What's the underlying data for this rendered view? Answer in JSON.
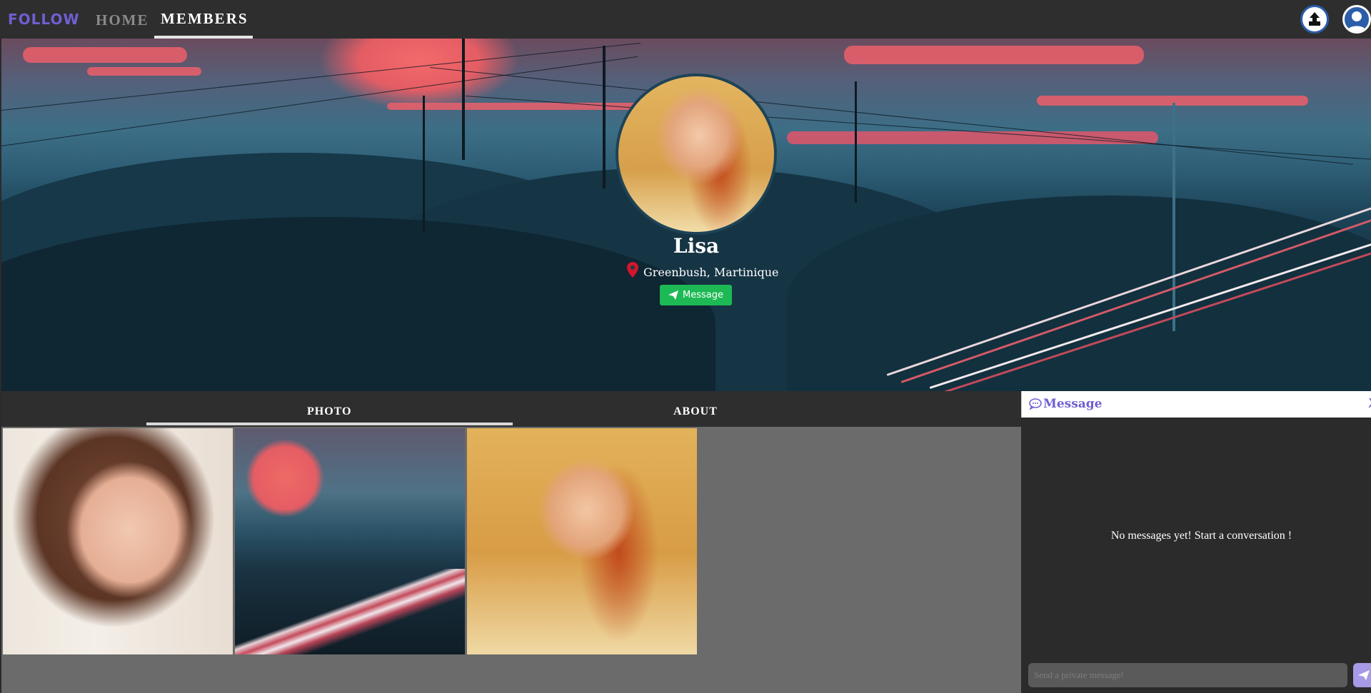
{
  "nav": {
    "logo": "FOLLOW",
    "home_label": "HOME",
    "members_label": "MEMBERS"
  },
  "profile": {
    "name": "Lisa",
    "location": "Greenbush, Martinique",
    "message_button": "Message"
  },
  "tabs": {
    "photo": "PHOTO",
    "about": "ABOUT"
  },
  "chat": {
    "title": "Message",
    "close": "X",
    "empty_text": "No messages yet! Start a conversation !",
    "input_placeholder": "Send a private message!"
  },
  "icons": {
    "upload": "upload-icon",
    "user": "user-icon",
    "location": "map-pin-icon",
    "send": "paper-plane-icon",
    "chat": "chat-bubble-icon"
  },
  "colors": {
    "accent": "#6f5fd3",
    "message_button": "#1db954",
    "pin": "#d2152a",
    "send_button": "#a79ae6"
  }
}
